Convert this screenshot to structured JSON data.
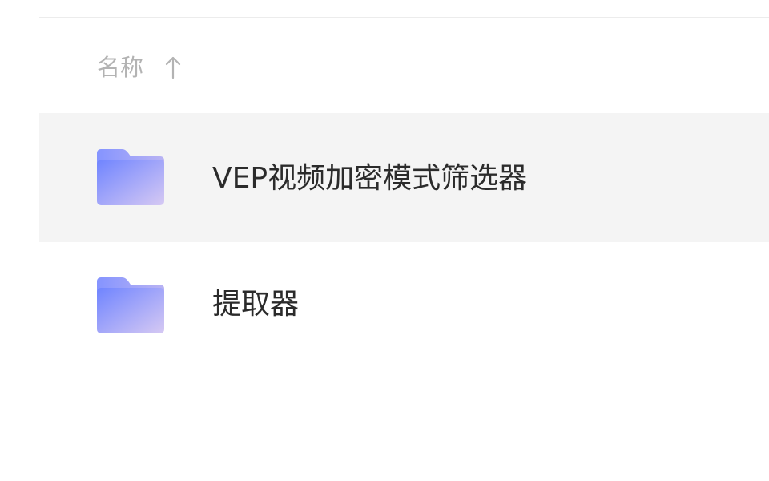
{
  "header": {
    "name_label": "名称",
    "sort_direction": "ascending",
    "sort_icon": "arrow-up-icon"
  },
  "files": [
    {
      "name": "VEP视频加密模式筛选器",
      "type": "folder",
      "icon": "folder-icon",
      "selected": true
    },
    {
      "name": "提取器",
      "type": "folder",
      "icon": "folder-icon",
      "selected": false
    }
  ],
  "colors": {
    "selected_row": "#f4f4f4",
    "folder_start": "#7b8cff",
    "folder_end": "#cfc8f5",
    "header_text": "#b3b3b3",
    "file_text": "#2b2b2b"
  }
}
